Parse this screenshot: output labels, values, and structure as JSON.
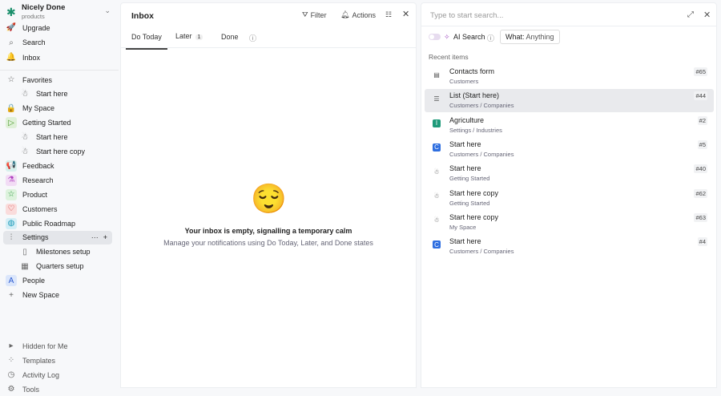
{
  "workspace": {
    "name": "Nicely Done",
    "sub": "products"
  },
  "nav": [
    {
      "label": "Upgrade",
      "icon": "rocket-icon",
      "glyph": "🚀"
    },
    {
      "label": "Search",
      "icon": "search-icon",
      "glyph": "⌕"
    },
    {
      "label": "Inbox",
      "icon": "bell-icon",
      "glyph": "🔔"
    }
  ],
  "spaces": [
    {
      "label": "Favorites",
      "icon": "star-icon",
      "glyph": "☆",
      "sub": false
    },
    {
      "label": "Start here",
      "icon": "doc-icon",
      "glyph": "☃",
      "sub": true
    },
    {
      "label": "My Space",
      "icon": "lock-icon",
      "glyph": "🔒",
      "sub": false
    },
    {
      "label": "Getting Started",
      "icon": "play-icon",
      "glyph": "▷",
      "sub": false,
      "bg": "#dff0d8",
      "color": "#4a9a2a"
    },
    {
      "label": "Start here",
      "icon": "doc-icon",
      "glyph": "☃",
      "sub": true
    },
    {
      "label": "Start here copy",
      "icon": "doc-icon",
      "glyph": "☃",
      "sub": true
    },
    {
      "label": "Feedback",
      "icon": "megaphone-icon",
      "glyph": "📢",
      "sub": false,
      "bg": "#d6f0ec",
      "color": "#1a8f7a"
    },
    {
      "label": "Research",
      "icon": "flask-icon",
      "glyph": "⚗",
      "sub": false,
      "bg": "#f2dcf5",
      "color": "#b040c0"
    },
    {
      "label": "Product",
      "icon": "star-icon",
      "glyph": "☆",
      "sub": false,
      "bg": "#ddf2dd",
      "color": "#2a9a3a"
    },
    {
      "label": "Customers",
      "icon": "heart-icon",
      "glyph": "♡",
      "sub": false,
      "bg": "#fadcdc",
      "color": "#d03030"
    },
    {
      "label": "Public Roadmap",
      "icon": "globe-icon",
      "glyph": "◍",
      "sub": false,
      "bg": "#d4eef6",
      "color": "#1a9ab8"
    },
    {
      "label": "Settings",
      "icon": "sliders-icon",
      "glyph": "⫶",
      "sub": false,
      "active": true
    },
    {
      "label": "Milestones setup",
      "icon": "bookmark-icon",
      "glyph": "▯",
      "sub": true
    },
    {
      "label": "Quarters setup",
      "icon": "calendar-icon",
      "glyph": "▦",
      "sub": true
    },
    {
      "label": "People",
      "icon": "people-icon",
      "glyph": "A",
      "sub": false,
      "bg": "#dbe6fb",
      "color": "#2a5ad0"
    },
    {
      "label": "New Space",
      "icon": "plus-icon",
      "glyph": "+",
      "sub": false
    }
  ],
  "settings_actions": {
    "more": "···",
    "add": "+"
  },
  "bottom": [
    {
      "label": "Hidden for Me",
      "icon": "caret-right-icon",
      "glyph": "▸"
    },
    {
      "label": "Templates",
      "icon": "templates-icon",
      "glyph": "⁘"
    },
    {
      "label": "Activity Log",
      "icon": "clock-icon",
      "glyph": "◷"
    },
    {
      "label": "Tools",
      "icon": "tools-icon",
      "glyph": "⚙"
    }
  ],
  "inbox": {
    "title": "Inbox",
    "filter": "Filter",
    "actions": "Actions",
    "tabs": {
      "today": "Do Today",
      "later": "Later",
      "later_count": "1",
      "done": "Done"
    },
    "empty_emoji": "😌",
    "empty_title": "Your inbox is empty, signalling a temporary calm",
    "empty_sub": "Manage your notifications using Do Today, Later, and Done states"
  },
  "search": {
    "placeholder": "Type to start search...",
    "ai_label": "AI Search",
    "what_label": "What:",
    "what_value": "Anything",
    "recent_label": "Recent items",
    "items": [
      {
        "title": "Contacts form",
        "path": "Customers",
        "num": "#65",
        "glyph": "▤"
      },
      {
        "title": "List (Start here)",
        "path": "Customers / Companies",
        "num": "#44",
        "glyph": "☰",
        "hl": true
      },
      {
        "title": "Agriculture",
        "path": "Settings / Industries",
        "num": "#2",
        "glyph": "I",
        "bg": "#1f9a7a"
      },
      {
        "title": "Start here",
        "path": "Customers / Companies",
        "num": "#5",
        "glyph": "C",
        "bg": "#2f6fe0"
      },
      {
        "title": "Start here",
        "path": "Getting Started",
        "num": "#40",
        "glyph": "☃"
      },
      {
        "title": "Start here copy",
        "path": "Getting Started",
        "num": "#62",
        "glyph": "☃"
      },
      {
        "title": "Start here copy",
        "path": "My Space",
        "num": "#63",
        "glyph": "☃"
      },
      {
        "title": "Start here",
        "path": "Customers / Companies",
        "num": "#4",
        "glyph": "C",
        "bg": "#2f6fe0"
      }
    ]
  }
}
